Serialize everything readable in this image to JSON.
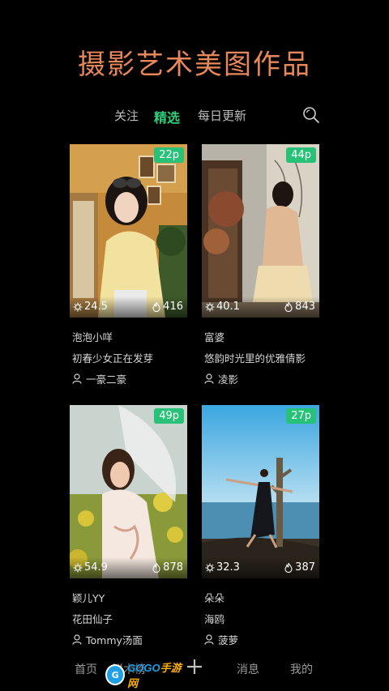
{
  "header": {
    "title": "摄影艺术美图作品"
  },
  "tabs": [
    {
      "label": "关注",
      "active": false
    },
    {
      "label": "精选",
      "active": true
    },
    {
      "label": "每日更新",
      "active": false
    }
  ],
  "search": {
    "icon": "search-icon"
  },
  "accent_color": "#2fcf7a",
  "title_color": "#e8875a",
  "cards": [
    {
      "count": "22p",
      "score": "24.5",
      "heat": "416",
      "author": "泡泡小咩",
      "caption": "初春少女正在发芽",
      "photographer": "一豪二豪"
    },
    {
      "count": "44p",
      "score": "40.1",
      "heat": "843",
      "author": "富婆",
      "caption": "悠韵时光里的优雅倩影",
      "photographer": "凌影"
    },
    {
      "count": "49p",
      "score": "54.9",
      "heat": "878",
      "author": "颖儿YY",
      "caption": "花田仙子",
      "photographer": "Tommy汤面"
    },
    {
      "count": "27p",
      "score": "32.3",
      "heat": "387",
      "author": "朵朵",
      "caption": "海鸥",
      "photographer": "菠萝"
    }
  ],
  "nav": {
    "home": "首页",
    "rank": "鲜木榜",
    "messages": "消息",
    "mine": "我的"
  },
  "watermark": {
    "brand_a": "GOGO",
    "brand_b": "手游网"
  }
}
